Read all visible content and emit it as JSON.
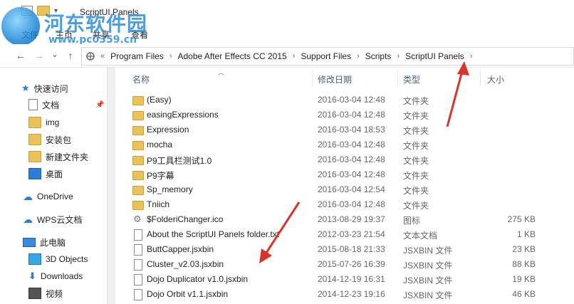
{
  "window": {
    "title": "ScriptUI Panels"
  },
  "ribbon": {
    "tabs": [
      "文件",
      "主页",
      "共享",
      "查看"
    ]
  },
  "watermark": {
    "text": "河东软件园",
    "url": "www.pc0359.cn"
  },
  "nav": {
    "back": "←",
    "forward": "→",
    "recent": "⌄",
    "up": "↑"
  },
  "address": {
    "prefix": "«",
    "crumbs": [
      "Program Files",
      "Adobe After Effects CC 2015",
      "Support Files",
      "Scripts",
      "ScriptUI Panels"
    ],
    "separator": "›",
    "dropdown": "›"
  },
  "sidebar": {
    "items": [
      {
        "label": "快速访问",
        "icon": "star-icon"
      },
      {
        "label": "文档",
        "icon": "documents-icon"
      },
      {
        "label": "img",
        "icon": "folder-icon"
      },
      {
        "label": "安装包",
        "icon": "folder-icon"
      },
      {
        "label": "新建文件夹",
        "icon": "folder-icon"
      },
      {
        "label": "桌面",
        "icon": "desktop-icon"
      },
      {
        "label": "OneDrive",
        "icon": "cloud-icon"
      },
      {
        "label": "WPS云文档",
        "icon": "cloud-icon"
      },
      {
        "label": "此电脑",
        "icon": "computer-icon"
      },
      {
        "label": "3D Objects",
        "icon": "cube-icon"
      },
      {
        "label": "Downloads",
        "icon": "download-icon"
      },
      {
        "label": "视频",
        "icon": "video-icon"
      }
    ]
  },
  "columns": {
    "name": "名称",
    "date": "修改日期",
    "type": "类型",
    "size": "大小"
  },
  "files": [
    {
      "name": "(Easy)",
      "date": "2016-03-04 12:48",
      "type": "文件夹",
      "size": "",
      "kind": "folder"
    },
    {
      "name": "easingExpressions",
      "date": "2016-03-04 12:48",
      "type": "文件夹",
      "size": "",
      "kind": "folder"
    },
    {
      "name": "Expression",
      "date": "2016-03-04 18:53",
      "type": "文件夹",
      "size": "",
      "kind": "folder"
    },
    {
      "name": "mocha",
      "date": "2016-03-04 12:48",
      "type": "文件夹",
      "size": "",
      "kind": "folder"
    },
    {
      "name": "P9工具栏测试1.0",
      "date": "2016-03-04 12:48",
      "type": "文件夹",
      "size": "",
      "kind": "folder"
    },
    {
      "name": "P9字幕",
      "date": "2016-03-04 12:48",
      "type": "文件夹",
      "size": "",
      "kind": "folder"
    },
    {
      "name": "Sp_memory",
      "date": "2016-03-04 12:54",
      "type": "文件夹",
      "size": "",
      "kind": "folder"
    },
    {
      "name": "Tniich",
      "date": "2016-03-04 12:48",
      "type": "文件夹",
      "size": "",
      "kind": "folder"
    },
    {
      "name": "$FolderiChanger.ico",
      "date": "2013-08-29 19:37",
      "type": "图标",
      "size": "275 KB",
      "kind": "ico"
    },
    {
      "name": "About the ScriptUI Panels folder.txt",
      "date": "2012-03-23 21:54",
      "type": "文本文档",
      "size": "1 KB",
      "kind": "file"
    },
    {
      "name": "ButtCapper.jsxbin",
      "date": "2015-08-18 21:33",
      "type": "JSXBIN 文件",
      "size": "23 KB",
      "kind": "file"
    },
    {
      "name": "Cluster_v2.03.jsxbin",
      "date": "2015-07-26 16:39",
      "type": "JSXBIN 文件",
      "size": "88 KB",
      "kind": "file"
    },
    {
      "name": "Dojo Duplicator v1.0.jsxbin",
      "date": "2014-12-19 16:31",
      "type": "JSXBIN 文件",
      "size": "19 KB",
      "kind": "file"
    },
    {
      "name": "Dojo Orbit v1.1.jsxbin",
      "date": "2014-12-23 19:16",
      "type": "JSXBIN 文件",
      "size": "46 KB",
      "kind": "file"
    }
  ],
  "colors": {
    "annotation_arrow": "#d9342b",
    "folder": "#e9c25a",
    "header_text": "#4c607a"
  }
}
